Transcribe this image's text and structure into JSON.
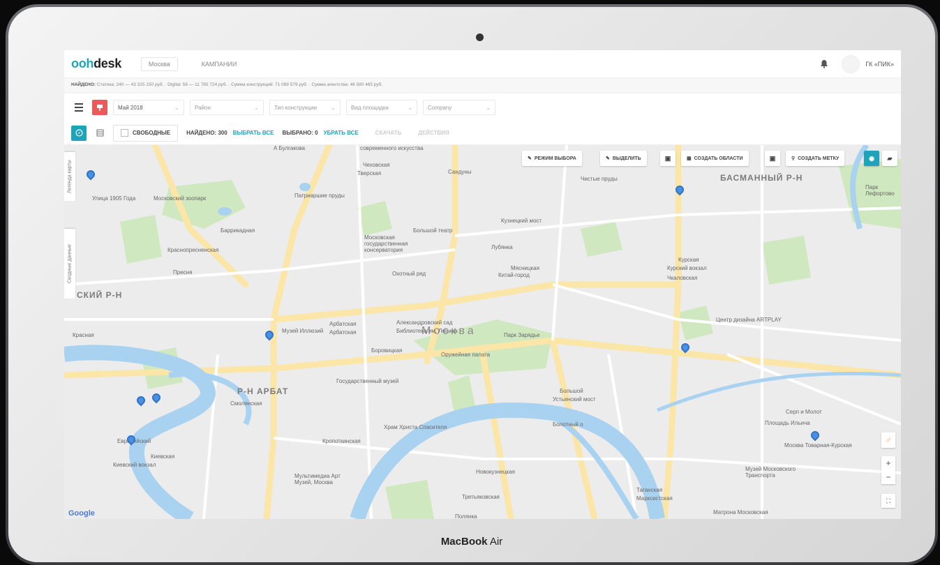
{
  "device": {
    "brand": "MacBook",
    "model": "Air"
  },
  "header": {
    "logo_part1": "ooh",
    "logo_part2": "desk",
    "city_tab": "Москва",
    "campaigns_tab": "КАМПАНИИ",
    "company_top": "",
    "company": "ГК «ПИК»"
  },
  "summary": {
    "found_label": "НАЙДЕНО:",
    "text": "Статика: 240 — 43 325 150 руб. · Digital: 56 — 11 765 724 руб. · Сумма конструкций: 71 089 579 руб. · Сумма агентства: 46 580 465 руб."
  },
  "filters": {
    "month": "Май 2018",
    "district": "Район",
    "construction_type": "Тип конструкции",
    "surface_type": "Вид площадки",
    "company": "Company"
  },
  "actions": {
    "free_label": "СВОБОДНЫЕ",
    "found": "НАЙДЕНО: 300",
    "select_all": "ВЫБРАТЬ ВСЕ",
    "selected": "ВЫБРАНО: 0",
    "remove_all": "УБРАТЬ ВСЕ",
    "download": "СКАЧАТЬ",
    "actions": "ДЕЙСТВИЯ"
  },
  "map_tools": {
    "select_mode": "РЕЖИМ ВЫБОРА",
    "highlight": "ВЫДЕЛИТЬ",
    "create_areas": "СОЗДАТЬ ОБЛАСТИ",
    "create_marker": "СОЗДАТЬ МЕТКУ"
  },
  "side_tabs": {
    "legend": "Легенда карты",
    "summary": "Сводные данные"
  },
  "map_labels": {
    "city": "Москва",
    "basmanny": "БАСМАННЫЙ Р-Н",
    "arbat": "Р-Н АРБАТ",
    "sky": "СКИЙ Р-Н",
    "ulitsa1905": "Улица 1905 Года",
    "zoo": "Московский зоопарк",
    "patriarshie": "Патриаршие пруды",
    "barrikadnaya": "Баррикадная",
    "krasnopresnenskaya": "Краснопресненская",
    "presnya": "Пресня",
    "chekhovskaya": "Чеховская",
    "tverskaya": "Тверская",
    "sandunovskie": "Сандуны",
    "chistye_prudy": "Чистые пруды",
    "kuznetsky": "Кузнецкий мост",
    "bolshoi": "Большой театр",
    "lubyanka": "Лубянка",
    "conservatory": "Московская государственная консерватория",
    "okhotny": "Охотный ряд",
    "kitay_gorod": "Китай-город",
    "kurskaya": "Курская",
    "kursky_vokzal": "Курский вокзал",
    "chkalovskaya": "Чкаловская",
    "center_design": "Центр дизайна ARTPLAY",
    "arbatskaya1": "Арбатская",
    "arbatskaya2": "Арбатская",
    "aleksandrovsky": "Александровский сад",
    "biblioteka": "Библиотека им. Ленина",
    "illusions": "Музей Иллюзий",
    "borovitskaya": "Боровицкая",
    "oruzheynaya": "Оружейная палата",
    "zaryadye": "Парк Зарядье",
    "smolenskaya": "Смоленская",
    "gosmuzey": "Государственный музей",
    "kropotkinskaya": "Кропоткинская",
    "hram": "Храм Христа Спасителя",
    "bolotny": "Болотный о",
    "evropeisky": "Европейский",
    "kievskaya": "Киевская",
    "kievsky_vokzal": "Киевский вокзал",
    "multimedia": "Мультимедиа Арт Музей, Москва",
    "novokuznetskaya": "Новокузнецкая",
    "tretyakovskaya": "Третьяковская",
    "polyanka": "Полянка",
    "serp_molot": "Серп и Молот",
    "ilyicha": "Площадь Ильича",
    "kursk_tovar": "Москва Товарная-Курская",
    "transport_museum": "Музей Московского Транспорта",
    "taganskaya": "Таганская",
    "marksistskaya": "Марксистская",
    "matrona": "Матрона Московская",
    "lefortovo": "Парк Лефортово",
    "bulgakov": "А Булгакова",
    "sovremennoe": "современного искусства",
    "krasnaya": "Красная",
    "myasnitskaya": "Мясницкая",
    "ustinsky": "Устьинский мост",
    "bolshoy_most": "Большой"
  },
  "google": "Google",
  "colors": {
    "accent": "#1fa3b8",
    "red": "#e95a5a",
    "water": "#a9d2f0",
    "park": "#cfe8c0",
    "road": "#fbe6a8"
  }
}
